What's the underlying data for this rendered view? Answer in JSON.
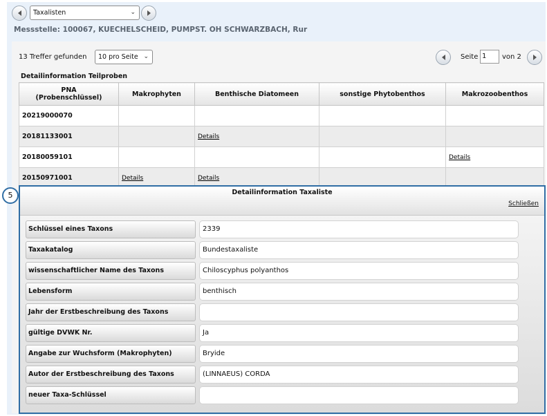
{
  "toolbar": {
    "prev_icon": "chevron-left-icon",
    "next_icon": "chevron-right-icon",
    "view_select": "Taxalisten"
  },
  "messstelle": "Messstelle: 100067, KUECHELSCHEID, PUMPST. OH SCHWARZBACH, Rur",
  "results": {
    "count_text": "13 Treffer gefunden",
    "per_page": "10 pro Seite",
    "page_label": "Seite",
    "page_value": "1",
    "of_label": "von 2"
  },
  "table": {
    "title": "Detailinformation Teilproben",
    "headers": [
      "PNA\n(Probenschlüssel)",
      "Makrophyten",
      "Benthische Diatomeen",
      "sonstige Phytobenthos",
      "Makrozoobenthos"
    ],
    "rows": [
      {
        "pna": "20219000070",
        "c1": "",
        "c2": "",
        "c3": "",
        "c4": ""
      },
      {
        "pna": "20181133001",
        "c1": "",
        "c2": "Details",
        "c3": "",
        "c4": ""
      },
      {
        "pna": "20180059101",
        "c1": "",
        "c2": "",
        "c3": "",
        "c4": "Details"
      },
      {
        "pna": "20150971001",
        "c1": "Details",
        "c2": "Details",
        "c3": "",
        "c4": ""
      }
    ]
  },
  "popup": {
    "badge": "5",
    "title": "Detailinformation Taxaliste",
    "close": "Schließen",
    "fields": [
      {
        "label": "Schlüssel eines Taxons",
        "value": "2339"
      },
      {
        "label": "Taxakatalog",
        "value": "Bundestaxaliste"
      },
      {
        "label": "wissenschaftlicher Name des Taxons",
        "value": "Chiloscyphus polyanthos"
      },
      {
        "label": "Lebensform",
        "value": "benthisch"
      },
      {
        "label": "Jahr der Erstbeschreibung des Taxons",
        "value": ""
      },
      {
        "label": "gültige DVWK Nr.",
        "value": "Ja"
      },
      {
        "label": "Angabe zur Wuchsform (Makrophyten)",
        "value": "Bryide"
      },
      {
        "label": "Autor der Erstbeschreibung des Taxons",
        "value": "(LINNAEUS) CORDA"
      },
      {
        "label": "neuer Taxa-Schlüssel",
        "value": ""
      }
    ]
  }
}
